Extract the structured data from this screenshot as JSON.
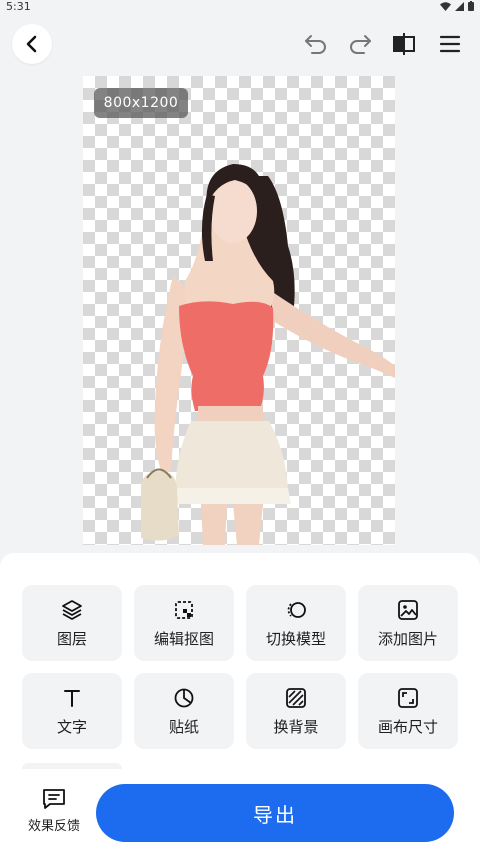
{
  "status_bar": {
    "time": "5:31"
  },
  "canvas": {
    "size_label": "800x1200"
  },
  "tools": [
    {
      "label": "图层",
      "icon": "layers-icon"
    },
    {
      "label": "编辑抠图",
      "icon": "edit-cutout-icon"
    },
    {
      "label": "切换模型",
      "icon": "switch-model-icon"
    },
    {
      "label": "添加图片",
      "icon": "image-icon"
    },
    {
      "label": "文字",
      "icon": "text-icon"
    },
    {
      "label": "贴纸",
      "icon": "sticker-icon"
    },
    {
      "label": "换背景",
      "icon": "background-icon"
    },
    {
      "label": "画布尺寸",
      "icon": "canvas-size-icon"
    }
  ],
  "feedback": {
    "label": "效果反馈"
  },
  "export": {
    "label": "导出"
  },
  "colors": {
    "accent": "#1d6cf0",
    "panel": "#ffffff",
    "page": "#f2f3f5"
  }
}
